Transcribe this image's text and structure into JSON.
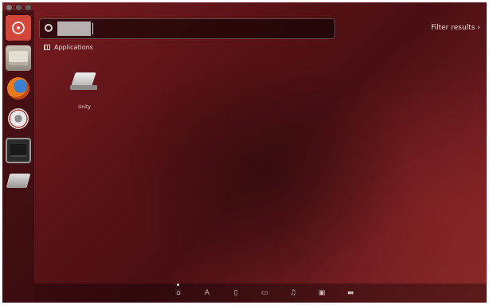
{
  "window": {
    "controls": [
      "close",
      "minimize",
      "maximize"
    ]
  },
  "launcher": {
    "items": [
      {
        "name": "dash-home",
        "icon": "ubuntu-logo-icon"
      },
      {
        "name": "files",
        "icon": "files-icon"
      },
      {
        "name": "firefox",
        "icon": "firefox-icon"
      },
      {
        "name": "system-settings",
        "icon": "gear-icon"
      },
      {
        "name": "terminal",
        "icon": "terminal-icon"
      },
      {
        "name": "laptop-app",
        "icon": "laptop-icon"
      }
    ]
  },
  "dash": {
    "search": {
      "value": "",
      "placeholder": ""
    },
    "filter_results_label": "Filter results",
    "filter_results_chevron": "›",
    "sections": [
      {
        "title": "Applications",
        "results": [
          {
            "label": "Unity",
            "icon": "laptop-icon"
          }
        ]
      }
    ]
  },
  "lenses": [
    {
      "name": "home",
      "glyph": "⌂",
      "active": true
    },
    {
      "name": "applications",
      "glyph": "A"
    },
    {
      "name": "files",
      "glyph": "▯"
    },
    {
      "name": "video",
      "glyph": "▭"
    },
    {
      "name": "music",
      "glyph": "♫"
    },
    {
      "name": "photos",
      "glyph": "▣"
    },
    {
      "name": "social",
      "glyph": "▬"
    }
  ],
  "colors": {
    "accent": "#d2473a",
    "background": "#5a1216"
  }
}
